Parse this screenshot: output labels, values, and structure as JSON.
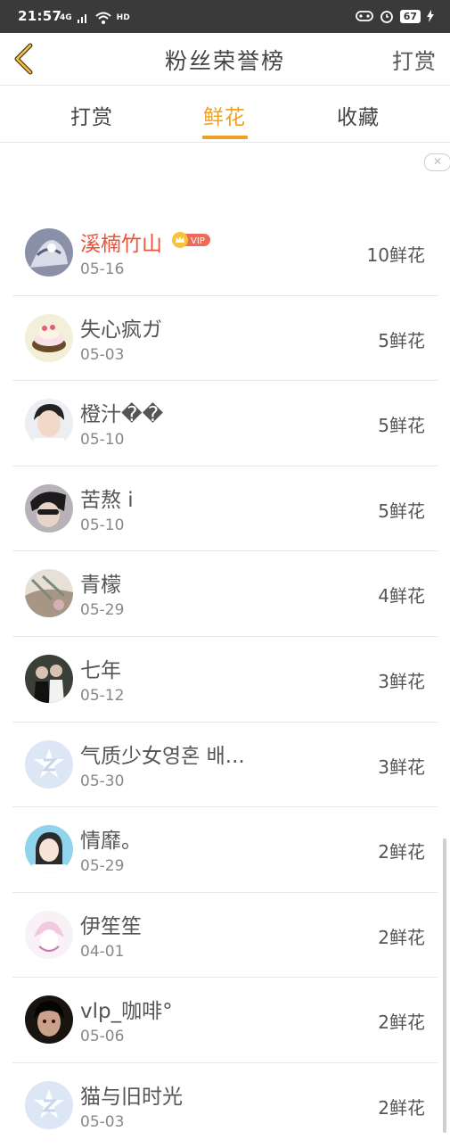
{
  "status_bar": {
    "time": "21:57",
    "network": "4G",
    "hd": "HD",
    "battery": "67",
    "colors": {
      "background": "#3a3a3a"
    }
  },
  "header": {
    "title": "粉丝荣誉榜",
    "action_label": "打赏",
    "back_icon": "chevron-left-icon"
  },
  "tabs": [
    {
      "label": "打赏",
      "active": false
    },
    {
      "label": "鲜花",
      "active": true
    },
    {
      "label": "收藏",
      "active": false
    }
  ],
  "accent_color": "#f0a020",
  "ad": {
    "close_icon": "close-icon"
  },
  "ranking": [
    {
      "name": "溪楠竹山",
      "date": "05-16",
      "count": "10鲜花",
      "vip": true,
      "vip_label": "VIP"
    },
    {
      "name": "失心疯ガ",
      "date": "05-03",
      "count": "5鲜花"
    },
    {
      "name": "橙汁��",
      "date": "05-10",
      "count": "5鲜花"
    },
    {
      "name": "苦熬 i",
      "date": "05-10",
      "count": "5鲜花"
    },
    {
      "name": "青檬",
      "date": "05-29",
      "count": "4鲜花"
    },
    {
      "name": "七年",
      "date": "05-12",
      "count": "3鲜花"
    },
    {
      "name": "气质少女영혼 배...",
      "date": "05-30",
      "count": "3鲜花"
    },
    {
      "name": "情靡。",
      "date": "05-29",
      "count": "2鲜花"
    },
    {
      "name": "伊笙笙",
      "date": "04-01",
      "count": "2鲜花"
    },
    {
      "name": "vlp_咖啡°",
      "date": "05-06",
      "count": "2鲜花"
    },
    {
      "name": "猫与旧时光",
      "date": "05-03",
      "count": "2鲜花"
    }
  ]
}
